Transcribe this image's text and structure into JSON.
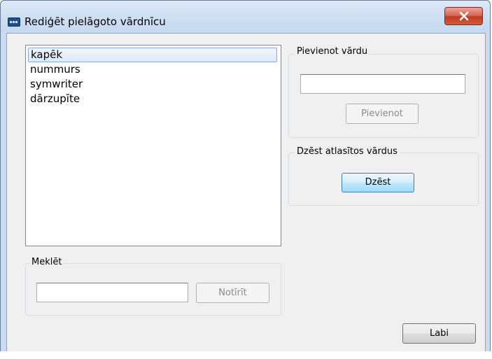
{
  "window": {
    "title": "Rediģēt pielāgoto vārdnīcu"
  },
  "word_list": {
    "items": [
      "kapēk",
      "nummurs",
      "symwriter",
      "dārzupīte"
    ],
    "selected_index": 0
  },
  "add_word": {
    "group_label": "Pievienot vārdu",
    "input_value": "",
    "button_label": "Pievienot"
  },
  "delete_words": {
    "group_label": "Dzēst atlasītos vārdus",
    "button_label": "Dzēst"
  },
  "search": {
    "group_label": "Meklēt",
    "input_value": "",
    "button_label": "Notīrīt"
  },
  "ok_button": {
    "label": "Labi"
  },
  "icons": {
    "app": "dictionary-app-icon",
    "close": "close-icon"
  },
  "colors": {
    "close_button": "#c9442c",
    "focus_border": "#3c7fb1",
    "selection": "#dbeafb"
  }
}
